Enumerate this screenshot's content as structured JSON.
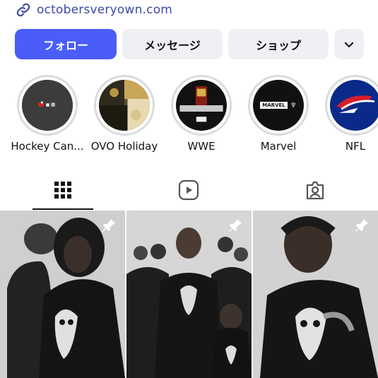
{
  "profile": {
    "link_text": "octobersveryown.com"
  },
  "actions": {
    "follow_label": "フォロー",
    "message_label": "メッセージ",
    "shop_label": "ショップ"
  },
  "highlights": [
    {
      "label": "Hockey Can..."
    },
    {
      "label": "OVO Holiday"
    },
    {
      "label": "WWE"
    },
    {
      "label": "Marvel"
    },
    {
      "label": "NFL"
    }
  ],
  "highlight_badges": {
    "marvel": "MARVEL"
  },
  "tabs": [
    {
      "icon": "grid-icon",
      "selected": true
    },
    {
      "icon": "reels-icon",
      "selected": false
    },
    {
      "icon": "tagged-icon",
      "selected": false
    }
  ],
  "posts": [
    {
      "pinned": true
    },
    {
      "pinned": true
    },
    {
      "pinned": true
    }
  ],
  "colors": {
    "accent": "#4a5df9",
    "link": "#3b4aa6",
    "button_gray": "#eef0f3"
  }
}
